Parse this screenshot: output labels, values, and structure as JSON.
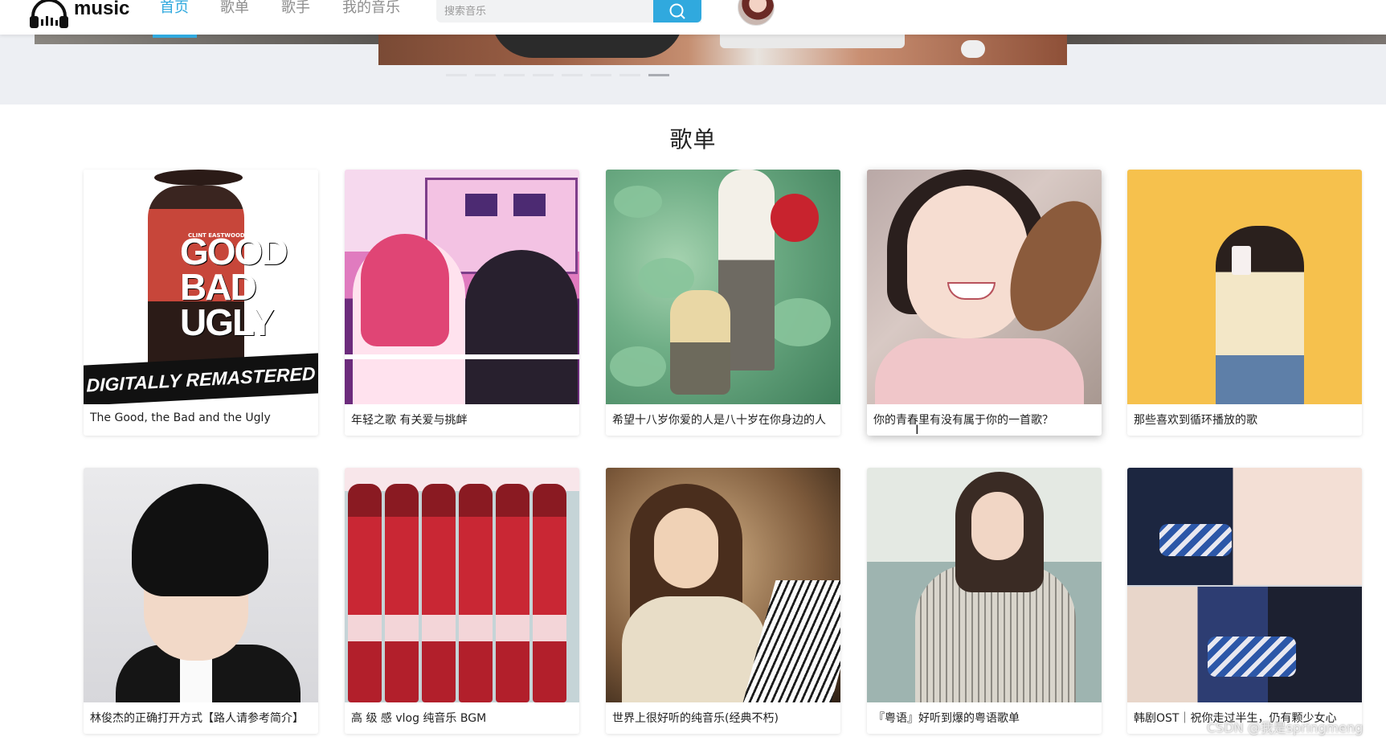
{
  "header": {
    "logo_text": "music",
    "nav": [
      {
        "label": "首页",
        "active": true
      },
      {
        "label": "歌单",
        "active": false
      },
      {
        "label": "歌手",
        "active": false
      },
      {
        "label": "我的音乐",
        "active": false
      }
    ],
    "search": {
      "placeholder": "搜索音乐",
      "value": ""
    },
    "search_icon": "search-icon",
    "accent_color": "#30a9de"
  },
  "banner": {
    "indicator_count": 8,
    "active_index": 7
  },
  "section": {
    "title": "歌单"
  },
  "playlists": [
    {
      "title": "The Good, the Bad and the Ugly",
      "cover_text_1": "GOOD BAD UGLY",
      "cover_text_2": "DIGITALLY REMASTERED",
      "cover_text_3": "CLINT EASTWOOD"
    },
    {
      "title": "年轻之歌 有关爱与挑衅"
    },
    {
      "title": "希望十八岁你爱的人是八十岁在你身边的人"
    },
    {
      "title": "你的青春里有没有属于你的一首歌？"
    },
    {
      "title": "那些喜欢到循环播放的歌"
    },
    {
      "title": "林俊杰的正确打开方式【路人请参考简介】"
    },
    {
      "title": "高 级 感 vlog 纯音乐 BGM"
    },
    {
      "title": "世界上很好听的纯音乐(经典不朽)"
    },
    {
      "title": "『粤语』好听到爆的粤语歌单"
    },
    {
      "title": "韩剧OST｜祝你走过半生，仍有颗少女心"
    }
  ],
  "watermark": "CSDN @我是springmeng"
}
